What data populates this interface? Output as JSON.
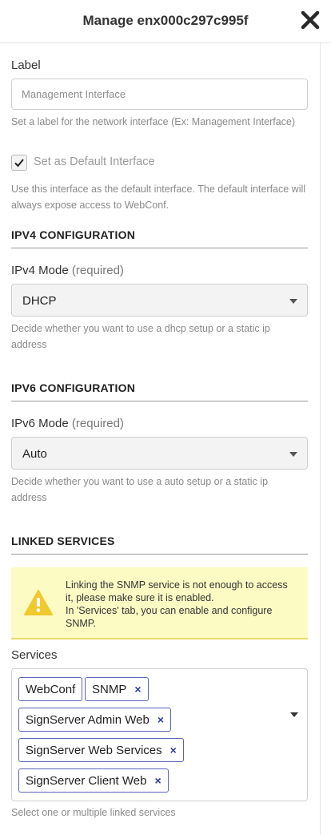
{
  "header": {
    "title": "Manage enx000c297c995f"
  },
  "label_field": {
    "label": "Label",
    "placeholder": "Management Interface",
    "help": "Set a label for the network interface (Ex: Management Interface)"
  },
  "default_interface": {
    "label": "Set as Default Interface",
    "checked": true,
    "help": "Use this interface as the default interface. The default interface will always expose access to WebConf."
  },
  "ipv4": {
    "section_title": "IPV4 CONFIGURATION",
    "mode_label": "IPv4 Mode",
    "required": "(required)",
    "value": "DHCP",
    "help": "Decide whether you want to use a dhcp setup or a static ip address"
  },
  "ipv6": {
    "section_title": "IPV6 CONFIGURATION",
    "mode_label": "IPv6 Mode",
    "required": "(required)",
    "value": "Auto",
    "help": "Decide whether you want to use a auto setup or a static ip address"
  },
  "linked_services": {
    "section_title": "LINKED SERVICES",
    "warning": {
      "line1": "Linking the SNMP service is not enough to access it, please make sure it is enabled.",
      "line2": "In 'Services' tab, you can enable and configure SNMP."
    },
    "services_label": "Services",
    "chips": [
      {
        "label": "WebConf",
        "removable": false
      },
      {
        "label": "SNMP",
        "removable": true
      },
      {
        "label": "SignServer Admin Web",
        "removable": true
      },
      {
        "label": "SignServer Web Services",
        "removable": true
      },
      {
        "label": "SignServer Client Web",
        "removable": true
      }
    ],
    "remove_glyph": "×",
    "help": "Select one or multiple linked services"
  },
  "colors": {
    "chip_border": "#5a63b8",
    "remove_x": "#2f3aa5",
    "warning_bg": "#fdfbc4",
    "warning_icon": "#f0c92e"
  }
}
